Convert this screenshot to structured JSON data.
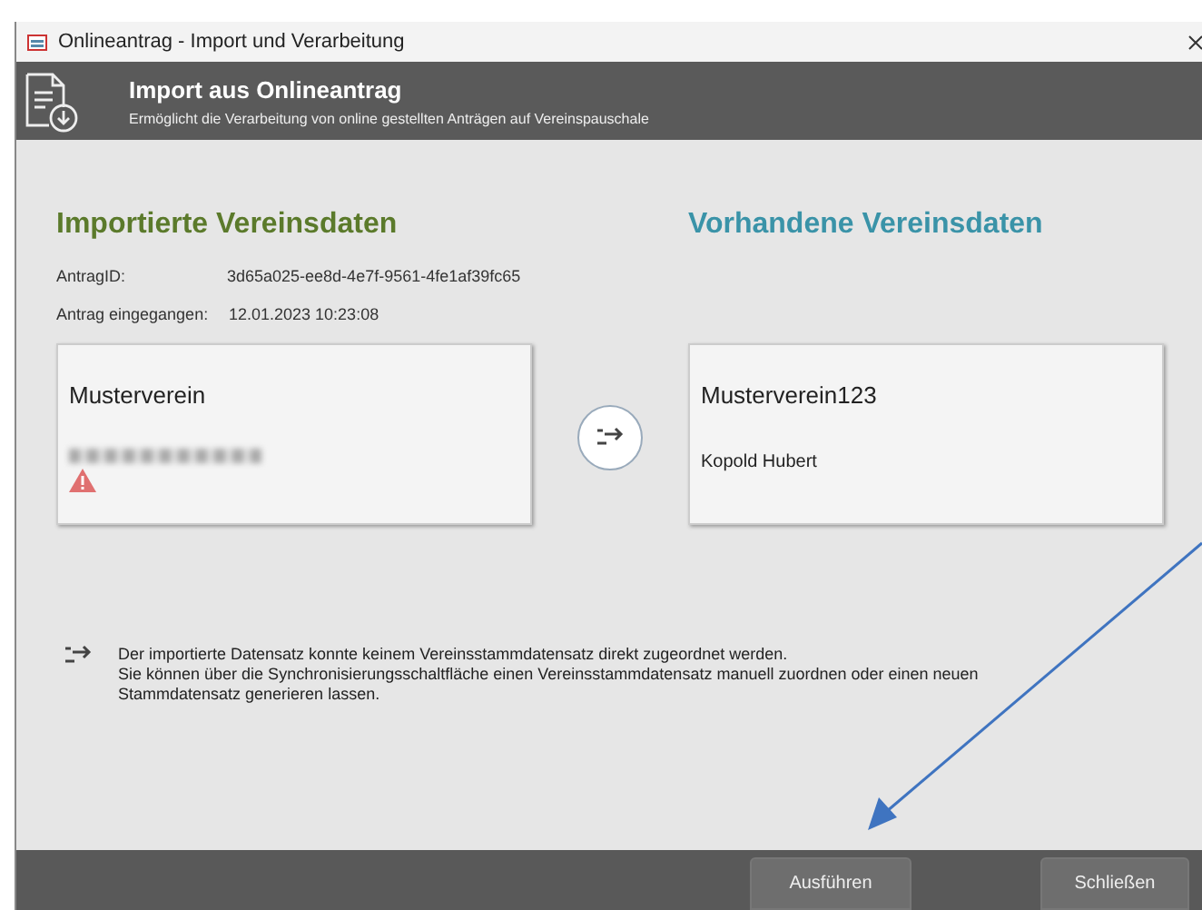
{
  "window": {
    "title": "Onlineantrag - Import und Verarbeitung"
  },
  "header": {
    "title": "Import aus Onlineantrag",
    "subtitle": "Ermöglicht die Verarbeitung von online gestellten Anträgen auf Vereinspauschale"
  },
  "imported": {
    "heading": "Importierte Vereinsdaten",
    "fields": [
      {
        "label": "AntragID:",
        "value": "3d65a025-ee8d-4e7f-9561-4fe1af39fc65"
      },
      {
        "label": "Antrag eingegangen:",
        "value": "12.01.2023 10:23:08"
      }
    ],
    "card": {
      "name": "Musterverein",
      "warning": true
    }
  },
  "existing": {
    "heading": "Vorhandene Vereinsdaten",
    "card": {
      "name": "Musterverein123",
      "contact": "Kopold Hubert"
    }
  },
  "info": [
    "Der importierte Datensatz konnte keinem Vereinsstammdatensatz direkt zugeordnet werden.",
    "Sie können über die Synchronisierungsschaltfläche einen Vereinsstammdatensatz manuell zuordnen oder einen neuen",
    "Stammdatensatz generieren lassen."
  ],
  "buttons": [
    "Ausführen",
    "Schließen"
  ]
}
